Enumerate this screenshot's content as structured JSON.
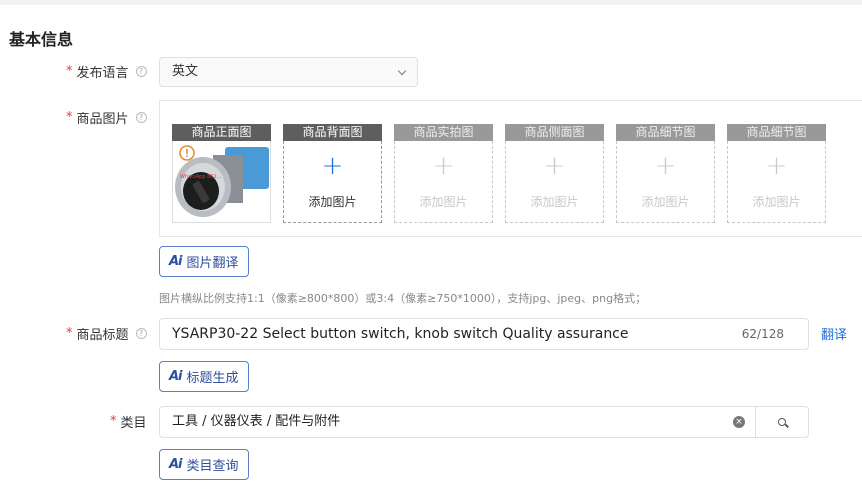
{
  "section": {
    "title": "基本信息"
  },
  "language": {
    "label": "发布语言",
    "required": "*",
    "value": "英文"
  },
  "images": {
    "label": "商品图片",
    "required": "*",
    "slots": [
      {
        "caption": "商品正面图",
        "state": "filled"
      },
      {
        "caption": "商品背面图",
        "state": "active",
        "add_label": "添加图片"
      },
      {
        "caption": "商品实拍图",
        "state": "disabled",
        "add_label": "添加图片"
      },
      {
        "caption": "商品侧面图",
        "state": "disabled",
        "add_label": "添加图片"
      },
      {
        "caption": "商品细节图",
        "state": "disabled",
        "add_label": "添加图片"
      },
      {
        "caption": "商品细节图",
        "state": "disabled",
        "add_label": "添加图片"
      }
    ],
    "ai_button_label": "图片翻译",
    "hint": "图片横纵比例支持1:1（像素≥800*800）或3:4（像素≥750*1000），支持jpg、jpeg、png格式；"
  },
  "product_title": {
    "label": "商品标题",
    "required": "*",
    "value": "YSARP30-22 Select button switch, knob switch Quality assurance",
    "count": "62/128",
    "translate_label": "翻译",
    "ai_button_label": "标题生成"
  },
  "category": {
    "label": "类目",
    "required": "*",
    "value": "工具 / 仪器仪表 / 配件与附件",
    "ai_button_label": "类目查询"
  },
  "icons": {
    "help": "question-circle-icon",
    "dropdown": "chevron-down-icon",
    "add": "plus-icon",
    "clear": "close-circle-icon",
    "search": "search-icon",
    "ai": "ai-icon",
    "warning": "info-circle-icon"
  },
  "colors": {
    "required": "#e23b3b",
    "link": "#1a6fd8",
    "ai_button": "#2c4f9e"
  }
}
